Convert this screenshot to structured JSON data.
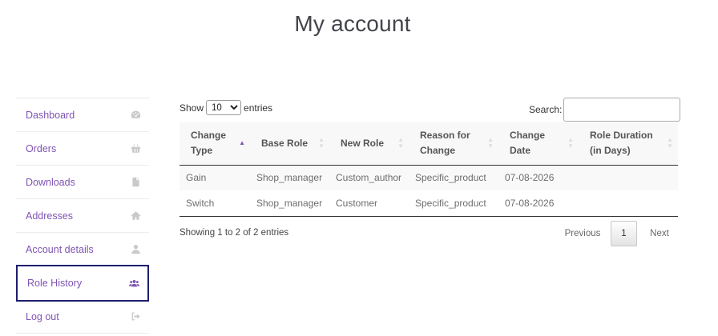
{
  "page": {
    "title": "My account"
  },
  "sidebar": {
    "items": [
      {
        "label": "Dashboard",
        "icon": "dashboard-icon",
        "active": false
      },
      {
        "label": "Orders",
        "icon": "basket-icon",
        "active": false
      },
      {
        "label": "Downloads",
        "icon": "file-icon",
        "active": false
      },
      {
        "label": "Addresses",
        "icon": "home-icon",
        "active": false
      },
      {
        "label": "Account details",
        "icon": "user-icon",
        "active": false
      },
      {
        "label": "Role History",
        "icon": "users-icon",
        "active": true
      },
      {
        "label": "Log out",
        "icon": "logout-icon",
        "active": false
      }
    ]
  },
  "table_controls": {
    "show_label": "Show",
    "entries_label": "entries",
    "length_selected": "10",
    "search_label": "Search:"
  },
  "table": {
    "columns": [
      "Change Type",
      "Base Role",
      "New Role",
      "Reason for Change",
      "Change Date",
      "Role Duration (in Days)"
    ],
    "rows": [
      [
        "Gain",
        "Shop_manager",
        "Custom_author",
        "Specific_product",
        "07-08-2026",
        ""
      ],
      [
        "Switch",
        "Shop_manager",
        "Customer",
        "Specific_product",
        "07-08-2026",
        ""
      ]
    ]
  },
  "footer": {
    "info": "Showing 1 to 2 of 2 entries",
    "previous": "Previous",
    "page": "1",
    "next": "Next"
  },
  "colors": {
    "link": "#7f54b3",
    "active_border": "#1d1e6f"
  }
}
